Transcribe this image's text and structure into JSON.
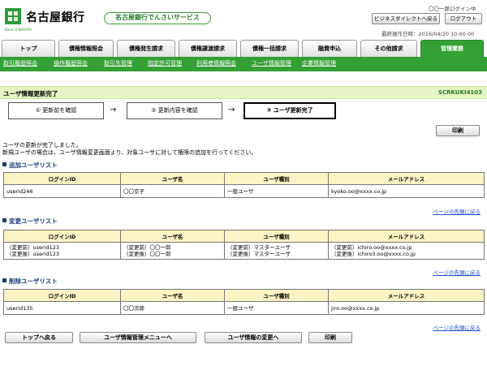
{
  "header": {
    "bank_name": "名古屋銀行",
    "bank_sub": "Bank of NAGOYA",
    "service_title": "名古屋銀行でんさいサービス",
    "login_message": "〇〇一郎ログイン中",
    "bizdirect_button": "ビジネスダイレクトへ戻る",
    "logout_button": "ログアウト",
    "last_operation": "最終操作日時：2016/04/20 10:00:00"
  },
  "tabs": [
    {
      "label": "トップ"
    },
    {
      "label": "債権情報照会"
    },
    {
      "label": "債権発生請求"
    },
    {
      "label": "債権譲渡請求"
    },
    {
      "label": "債権一括請求"
    },
    {
      "label": "融資申込"
    },
    {
      "label": "その他請求"
    },
    {
      "label": "管理業務"
    }
  ],
  "subnav": [
    {
      "label": "取引履歴照会"
    },
    {
      "label": "操作履歴照会"
    },
    {
      "label": "取引先管理"
    },
    {
      "label": "指定許可管理"
    },
    {
      "label": "利用者情報照会"
    },
    {
      "label": "ユーザ情報管理"
    },
    {
      "label": "企業情報管理"
    }
  ],
  "page": {
    "title": "ユーザ情報更新完了",
    "screen_id": "SCRKUKI4103"
  },
  "steps": [
    {
      "label": "① 更新前を確認"
    },
    {
      "label": "② 更新内容を確認"
    },
    {
      "label": "③ ユーザ更新完了"
    }
  ],
  "print_label": "印刷",
  "messages": {
    "line1": "ユーザの更新が完了しました。",
    "line2": "新規ユーザの場合は、ユーザ情報変更画面より、対象ユーザに対して権限の追加を行ってください。"
  },
  "columns": {
    "login_id": "ログインID",
    "user_name": "ユーザ名",
    "user_type": "ユーザ種別",
    "email": "メールアドレス"
  },
  "sections": {
    "added": {
      "title": "追加ユーザリスト",
      "rows": [
        {
          "login_id": "userid246",
          "user_name": "〇〇京子",
          "user_type": "一般ユーザ",
          "email": "kyoko.oo@xxxx.co.jp"
        }
      ]
    },
    "changed": {
      "title": "変更ユーザリスト",
      "rows": [
        {
          "login_id_before": "（変更前）userid123",
          "login_id_after": "（変更後）userid123",
          "user_name_before": "（変更前）〇〇一郎",
          "user_name_after": "（変更後）〇〇一郎",
          "user_type_before": "（変更前）マスターユーザ",
          "user_type_after": "（変更後）マスターユーザ",
          "email_before": "（変更前）ichiro.oo@xxxx.co.jp",
          "email_after": "（変更後）ichiro3.oo@xxxx.co.jp"
        }
      ]
    },
    "deleted": {
      "title": "削除ユーザリスト",
      "rows": [
        {
          "login_id": "userid135",
          "user_name": "〇〇次郎",
          "user_type": "一般ユーザ",
          "email": "jiro.oo@xxxx.co.jp"
        }
      ]
    }
  },
  "page_top_link": "ページの先頭に戻る",
  "footer_buttons": {
    "back_top": "トップへ戻る",
    "user_menu": "ユーザ情報管理メニューへ",
    "user_change": "ユーザ情報の変更へ",
    "print": "印刷"
  }
}
